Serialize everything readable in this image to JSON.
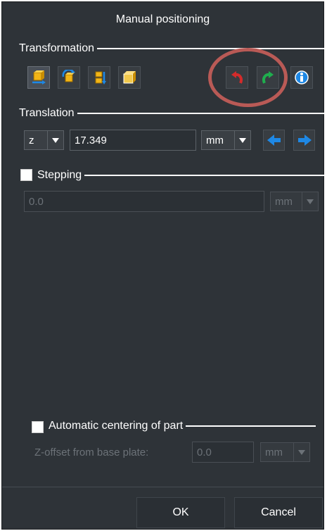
{
  "dialog": {
    "title": "Manual positioning"
  },
  "transformation": {
    "label": "Transformation",
    "tools": [
      {
        "name": "move-part",
        "icon": "move-part-icon"
      },
      {
        "name": "rotate-part",
        "icon": "rotate-part-icon"
      },
      {
        "name": "align-part",
        "icon": "align-part-icon"
      },
      {
        "name": "scale-part",
        "icon": "scale-part-icon"
      }
    ],
    "undo_icon": "undo-icon",
    "redo_icon": "redo-icon",
    "info_icon": "info-icon"
  },
  "translation": {
    "label": "Translation",
    "axis": "z",
    "value": "17.349",
    "unit": "mm"
  },
  "stepping": {
    "label": "Stepping",
    "checked": false,
    "value": "0.0",
    "unit": "mm"
  },
  "centering": {
    "label": "Automatic centering of part",
    "checked": false,
    "zoffset_label": "Z-offset from base plate:",
    "zoffset_value": "0.0",
    "zoffset_unit": "mm"
  },
  "buttons": {
    "ok": "OK",
    "cancel": "Cancel"
  },
  "colors": {
    "background": "#2e3338",
    "undo": "#d32b2b",
    "redo": "#1fae4e",
    "arrow": "#1e88e5",
    "highlight_circle": "#b95a56"
  }
}
